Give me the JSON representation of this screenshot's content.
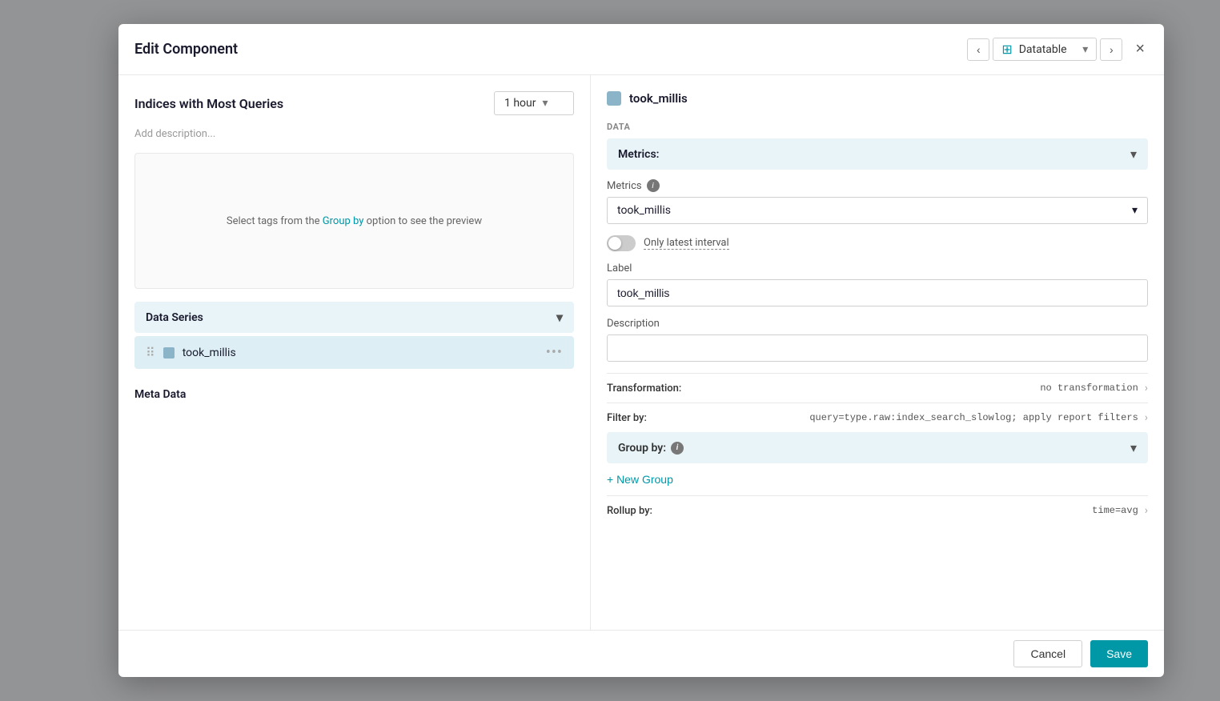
{
  "modal": {
    "title": "Edit Component",
    "close_label": "×",
    "nav": {
      "prev_icon": "‹",
      "next_icon": "›",
      "type_icon": "⊞",
      "type_label": "Datatable",
      "type_caret": "▾"
    },
    "left": {
      "comp_title": "Indices with Most Queries",
      "add_description": "Add description...",
      "time_label": "1 hour",
      "time_caret": "▾",
      "preview": {
        "text_before": "Select tags from the ",
        "link": "Group by",
        "text_after": " option to see the preview"
      },
      "data_series": {
        "label": "Data Series",
        "caret": "▾",
        "items": [
          {
            "name": "took_millis",
            "color": "#8bb4c8",
            "more_icon": "•••"
          }
        ]
      },
      "meta_data_label": "Meta Data"
    },
    "right": {
      "series_name": "took_millis",
      "series_color": "#8bb4c8",
      "data_section_label": "DATA",
      "metrics_section": {
        "label": "Metrics:",
        "caret": "▾"
      },
      "metrics_field": {
        "label": "Metrics",
        "has_info": true,
        "value": "took_millis",
        "caret": "▾"
      },
      "toggle": {
        "label": "Only latest interval",
        "enabled": false
      },
      "label_field": {
        "label": "Label",
        "placeholder": "took_millis",
        "value": "took_millis"
      },
      "description_field": {
        "label": "Description",
        "placeholder": "",
        "value": ""
      },
      "transformation_row": {
        "label": "Transformation:",
        "value": "no transformation",
        "caret": "›"
      },
      "filter_row": {
        "label": "Filter by:",
        "value": "query=type.raw:index_search_slowlog; apply report filters",
        "caret": "›"
      },
      "group_by_row": {
        "label": "Group by:",
        "has_info": true,
        "caret": "▾"
      },
      "new_group_btn": "+ New Group",
      "rollup_row": {
        "label": "Rollup by:",
        "value": "time=avg",
        "caret": "›"
      }
    },
    "footer": {
      "cancel_label": "Cancel",
      "save_label": "Save"
    }
  }
}
